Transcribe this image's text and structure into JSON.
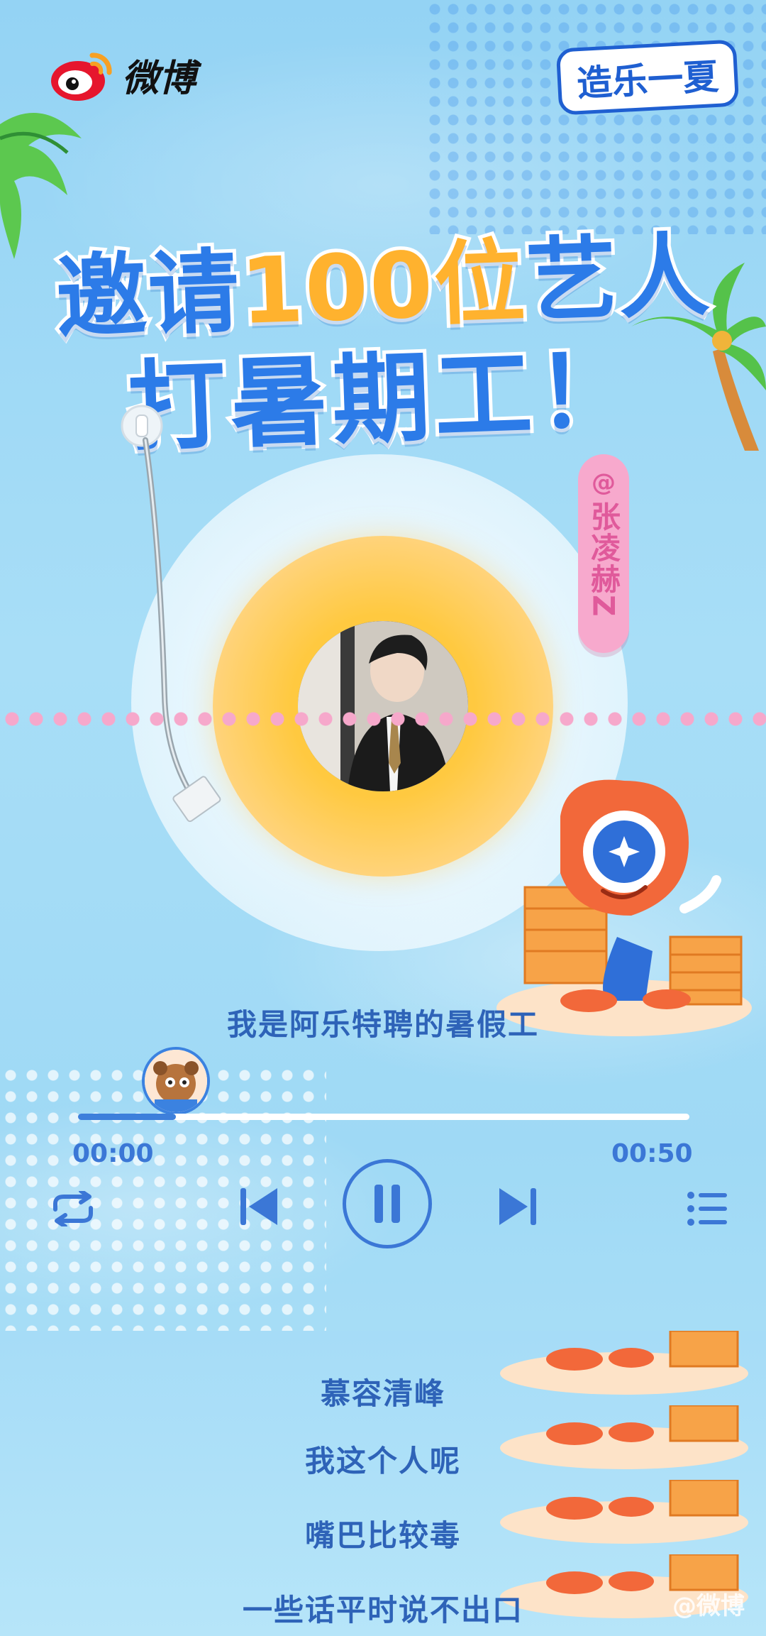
{
  "header": {
    "app_name": "微博",
    "campaign_logo": "造乐一夏"
  },
  "headline": {
    "line1_prefix": "邀请",
    "line1_highlight": "100位",
    "line1_suffix": "艺人",
    "line2": "打暑期工！"
  },
  "artist_tag": {
    "at_symbol": "@",
    "name": "张凌赫Z"
  },
  "player": {
    "current_lyric": "我是阿乐特聘的暑假工",
    "time_elapsed": "00:00",
    "time_total": "00:50",
    "progress_fraction": 0.16,
    "controls": [
      "repeat-icon",
      "previous-icon",
      "pause-icon",
      "next-icon",
      "playlist-icon"
    ]
  },
  "lyrics": [
    "慕容清峰",
    "我这个人呢",
    "嘴巴比较毒",
    "一些话平时说不出口"
  ],
  "watermark": "@微博",
  "colors": {
    "primary_blue": "#2c7be8",
    "accent_orange": "#ffb22e",
    "tag_pink": "#f7a9cd",
    "lyric_blue": "#2e63b8"
  }
}
